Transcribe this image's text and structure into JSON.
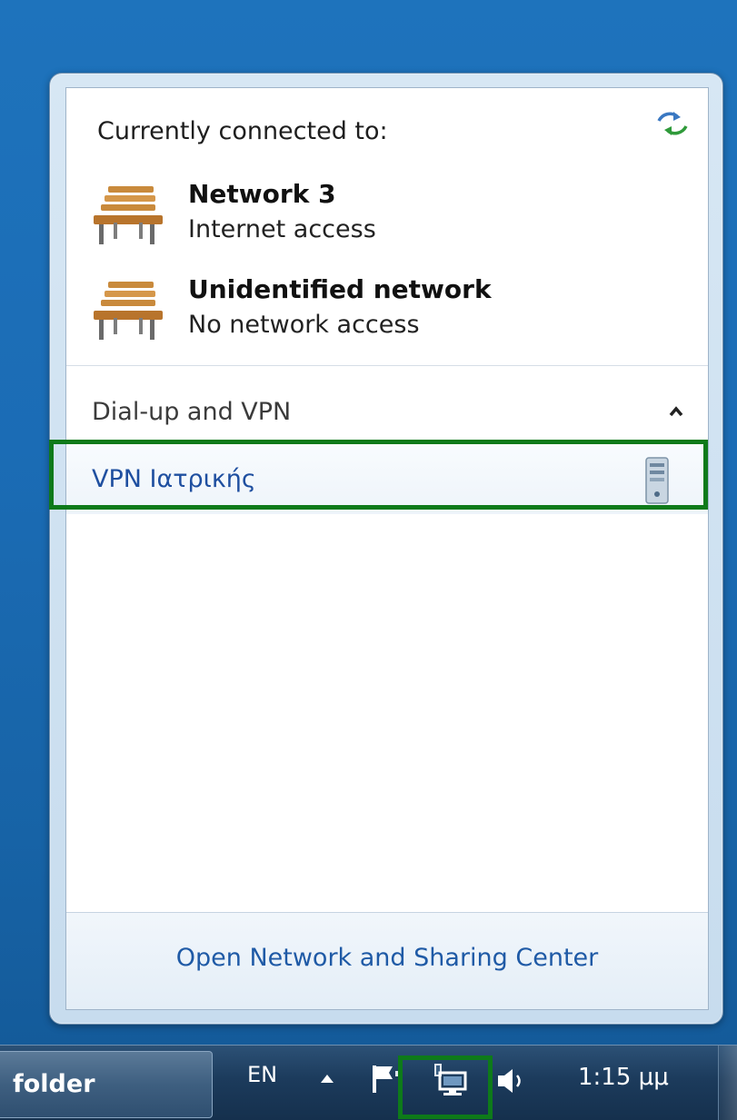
{
  "flyout": {
    "heading": "Currently connected to:",
    "networks": [
      {
        "name": "Network  3",
        "status": "Internet access",
        "icon": "bench-icon"
      },
      {
        "name": "Unidentified network",
        "status": "No network access",
        "icon": "bench-icon"
      }
    ],
    "group": {
      "label": "Dial-up and VPN",
      "state": "expanded"
    },
    "vpn": {
      "label": "VPN Ιατρικής",
      "icon": "server-icon"
    },
    "footer_link": "Open Network and Sharing Center",
    "refresh_icon": "refresh-icon"
  },
  "taskbar": {
    "task_button_label": "folder",
    "language": "EN",
    "clock": "1:15 μμ",
    "tray_icons": [
      "show-hidden-icons-arrow",
      "action-center-flag-icon",
      "network-icon",
      "volume-icon"
    ]
  },
  "colors": {
    "highlight": "#0e7a1a",
    "link": "#1f5aa6",
    "vpn_text": "#1f4fa0",
    "desktop": "#1b6cb5"
  }
}
